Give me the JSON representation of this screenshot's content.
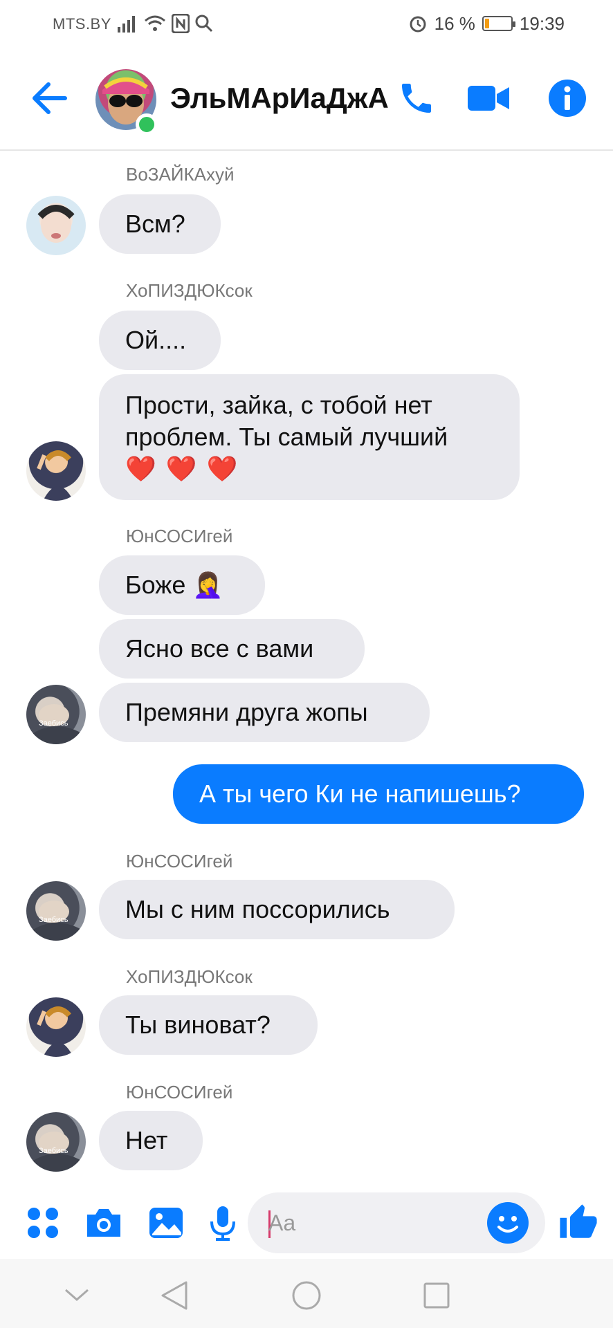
{
  "status": {
    "carrier": "MTS.BY",
    "battery": "16 %",
    "battery_level": 0.16,
    "time": "19:39"
  },
  "header": {
    "title": "ЭльМАрИаДжА",
    "online": true
  },
  "messages": [
    {
      "sender": "ВоЗАЙКАхуй",
      "text": "Всм?"
    },
    {
      "sender": "ХоПИЗДЮКсок",
      "text": "Ой...."
    },
    {
      "text": "Прости, зайка, с тобой нет проблем. Ты самый лучший",
      "emoji": "❤️ ❤️ ❤️"
    },
    {
      "sender": "ЮнСОСИгей",
      "text": "Боже 🤦‍♀️"
    },
    {
      "text": "Ясно все с вами"
    },
    {
      "text": "Премяни друга жопы"
    },
    {
      "text": "А ты чего Ки не напишешь?",
      "mine": true
    },
    {
      "sender": "ЮнСОСИгей",
      "text": "Мы с ним поссорились"
    },
    {
      "sender": "ХоПИЗДЮКсок",
      "text": "Ты виноват?"
    },
    {
      "sender": "ЮнСОСИгей",
      "text": "Нет"
    }
  ],
  "avatar_overlay_text": "Заебись",
  "composer": {
    "placeholder": "Aa"
  },
  "colors": {
    "accent": "#0a7cff",
    "bubble_gray": "#e9e9ee",
    "online": "#30c15b",
    "heart": "#e0293b"
  }
}
